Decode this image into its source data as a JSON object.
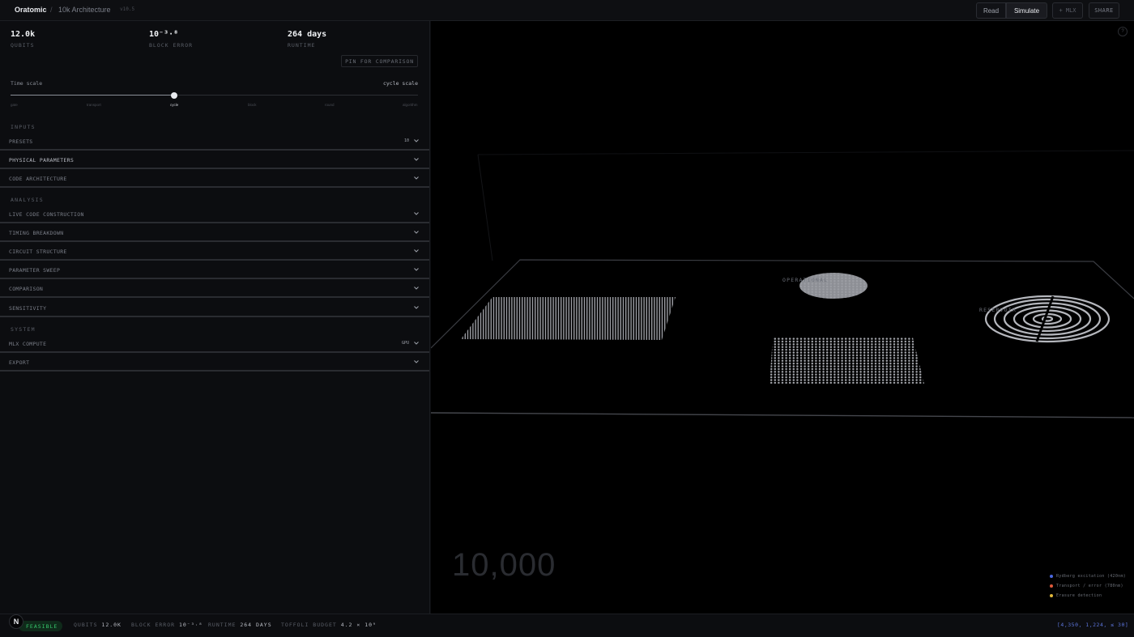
{
  "header": {
    "brand": "Oratomic",
    "separator": "/",
    "breadcrumb": "10k Architecture",
    "version": "v10.5",
    "modes": [
      "Read",
      "Simulate"
    ],
    "mlx_label": "+ MLX",
    "share_label": "SHARE"
  },
  "stats": [
    {
      "value": "12.0k",
      "label": "QUBITS"
    },
    {
      "value": "10⁻³·⁸",
      "label": "BLOCK ERROR"
    },
    {
      "value": "264 days",
      "label": "RUNTIME"
    }
  ],
  "pin_label": "PIN FOR COMPARISON",
  "timescale": {
    "label": "Time scale",
    "value": "cycle scale",
    "ticks": [
      "gate",
      "transport",
      "cycle",
      "block",
      "round",
      "algorithm"
    ],
    "active_index": 2,
    "position": 0.4
  },
  "sections": {
    "inputs": "INPUTS",
    "analysis": "ANALYSIS",
    "system": "SYSTEM"
  },
  "inputs": [
    {
      "label": "PRESETS",
      "value": "10"
    },
    {
      "label": "PHYSICAL PARAMETERS",
      "value": ""
    },
    {
      "label": "CODE ARCHITECTURE",
      "value": ""
    }
  ],
  "analysis": [
    {
      "label": "LIVE CODE CONSTRUCTION"
    },
    {
      "label": "TIMING BREAKDOWN"
    },
    {
      "label": "CIRCUIT STRUCTURE"
    },
    {
      "label": "PARAMETER SWEEP"
    },
    {
      "label": "COMPARISON"
    },
    {
      "label": "SENSITIVITY"
    }
  ],
  "system": [
    {
      "label": "MLX COMPUTE",
      "value": "GPU"
    },
    {
      "label": "EXPORT",
      "value": ""
    }
  ],
  "viewport": {
    "help": "?",
    "count": "10,000",
    "zones": {
      "operational": "OPERATIONAL",
      "reservoir": "RESERVOIR"
    },
    "legend": [
      {
        "label": "Rydberg excitation (420nm)",
        "color": "#4a67e0"
      },
      {
        "label": "Transport / error (780nm)",
        "color": "#e0593a"
      },
      {
        "label": "Erasure detection",
        "color": "#e0b83a"
      }
    ]
  },
  "footer": {
    "logo": "N",
    "status": "FEASIBLE",
    "qubits_label": "QUBITS",
    "qubits_value": "12.0K",
    "error_label": "BLOCK ERROR",
    "error_value": "10⁻³·⁸",
    "runtime_label": "RUNTIME",
    "runtime_value": "264 DAYS",
    "toffoli_label": "TOFFOLI BUDGET",
    "toffoli_value": "4.2 × 10⁹",
    "coords": "[4,350, 1,224, ≤ 30]"
  },
  "colors": {
    "accent_green": "#35c46a",
    "accent_blue": "#5b73d8",
    "background": "#0c0d10"
  }
}
